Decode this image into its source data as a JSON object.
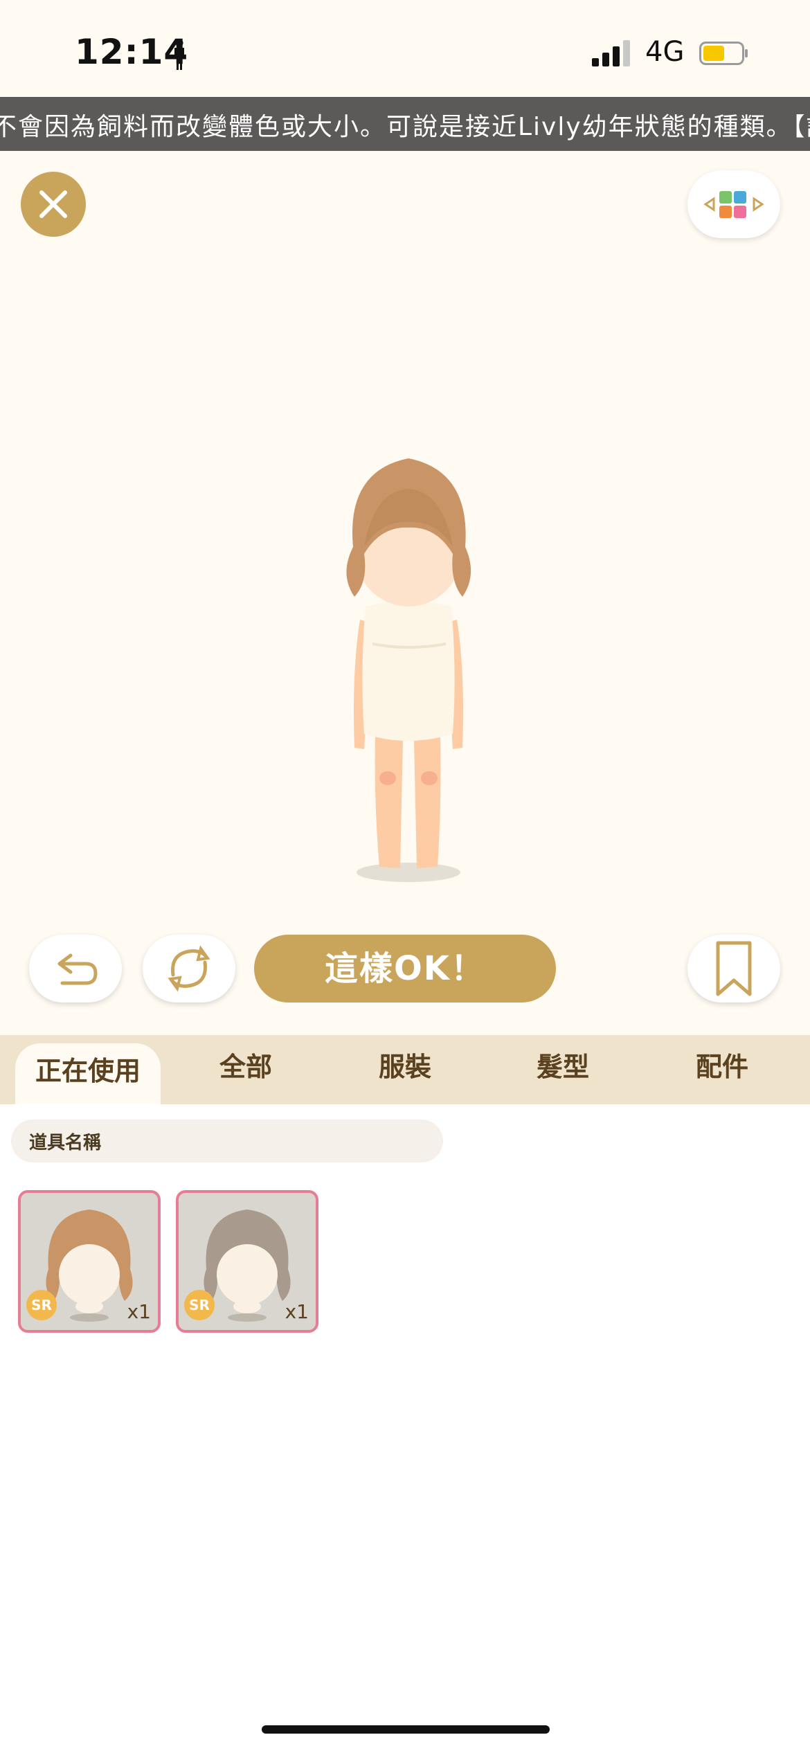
{
  "status_bar": {
    "time": "12:14",
    "network": "4G"
  },
  "ticker": {
    "text": "不會因為飼料而改變體色或大小。可說是接近Livly幼年狀態的種類。【詳"
  },
  "actions": {
    "ok_label": "這樣OK！"
  },
  "tabs": [
    {
      "label": "正在使用",
      "active": true
    },
    {
      "label": "全部",
      "active": false
    },
    {
      "label": "服裝",
      "active": false
    },
    {
      "label": "髮型",
      "active": false
    },
    {
      "label": "配件",
      "active": false
    }
  ],
  "search": {
    "placeholder": "道具名稱"
  },
  "items": [
    {
      "rarity": "SR",
      "quantity": "x1",
      "hair_color": "#c99566"
    },
    {
      "rarity": "SR",
      "quantity": "x1",
      "hair_color": "#a89a8c"
    }
  ],
  "colors": {
    "accent_gold": "#c9a45b",
    "cream": "#fffaf2",
    "tab_bar": "#efe3cc",
    "ticker_bg": "#5c5a58",
    "card_border": "#e77c93",
    "badge": "#f2b84b"
  },
  "icons": {
    "close": "close-icon",
    "color_palette": "palette-arrows-icon",
    "undo": "undo-icon",
    "refresh": "refresh-icon",
    "bookmark": "bookmark-icon"
  }
}
